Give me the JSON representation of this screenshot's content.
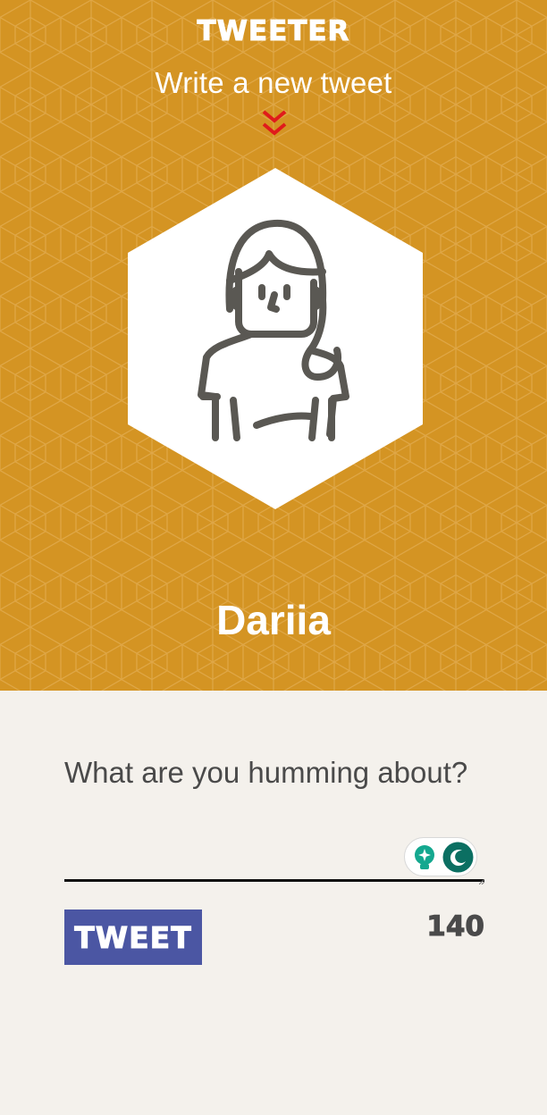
{
  "header": {
    "brand": "Tweeter",
    "subtitle": "Write a new tweet",
    "chevron_icon": "double-chevron-down",
    "avatar_icon": "woman-avatar-outline",
    "username": "Dariia"
  },
  "composer": {
    "prompt": "What are you humming about?",
    "input_value": "",
    "tweet_button_label": "Tweet",
    "char_counter": "140",
    "grammar_widget": {
      "bulb_icon": "lightbulb-sparkle-icon",
      "moon_icon": "crescent-moon-icon"
    }
  },
  "colors": {
    "header_background": "#d49423",
    "page_background": "#f4f1ec",
    "button_background": "#4b56a3",
    "chevron": "#e01b1b",
    "avatar_stroke": "#5a5853",
    "widget_teal": "#14a88f",
    "widget_dark_teal": "#0b6f62"
  }
}
